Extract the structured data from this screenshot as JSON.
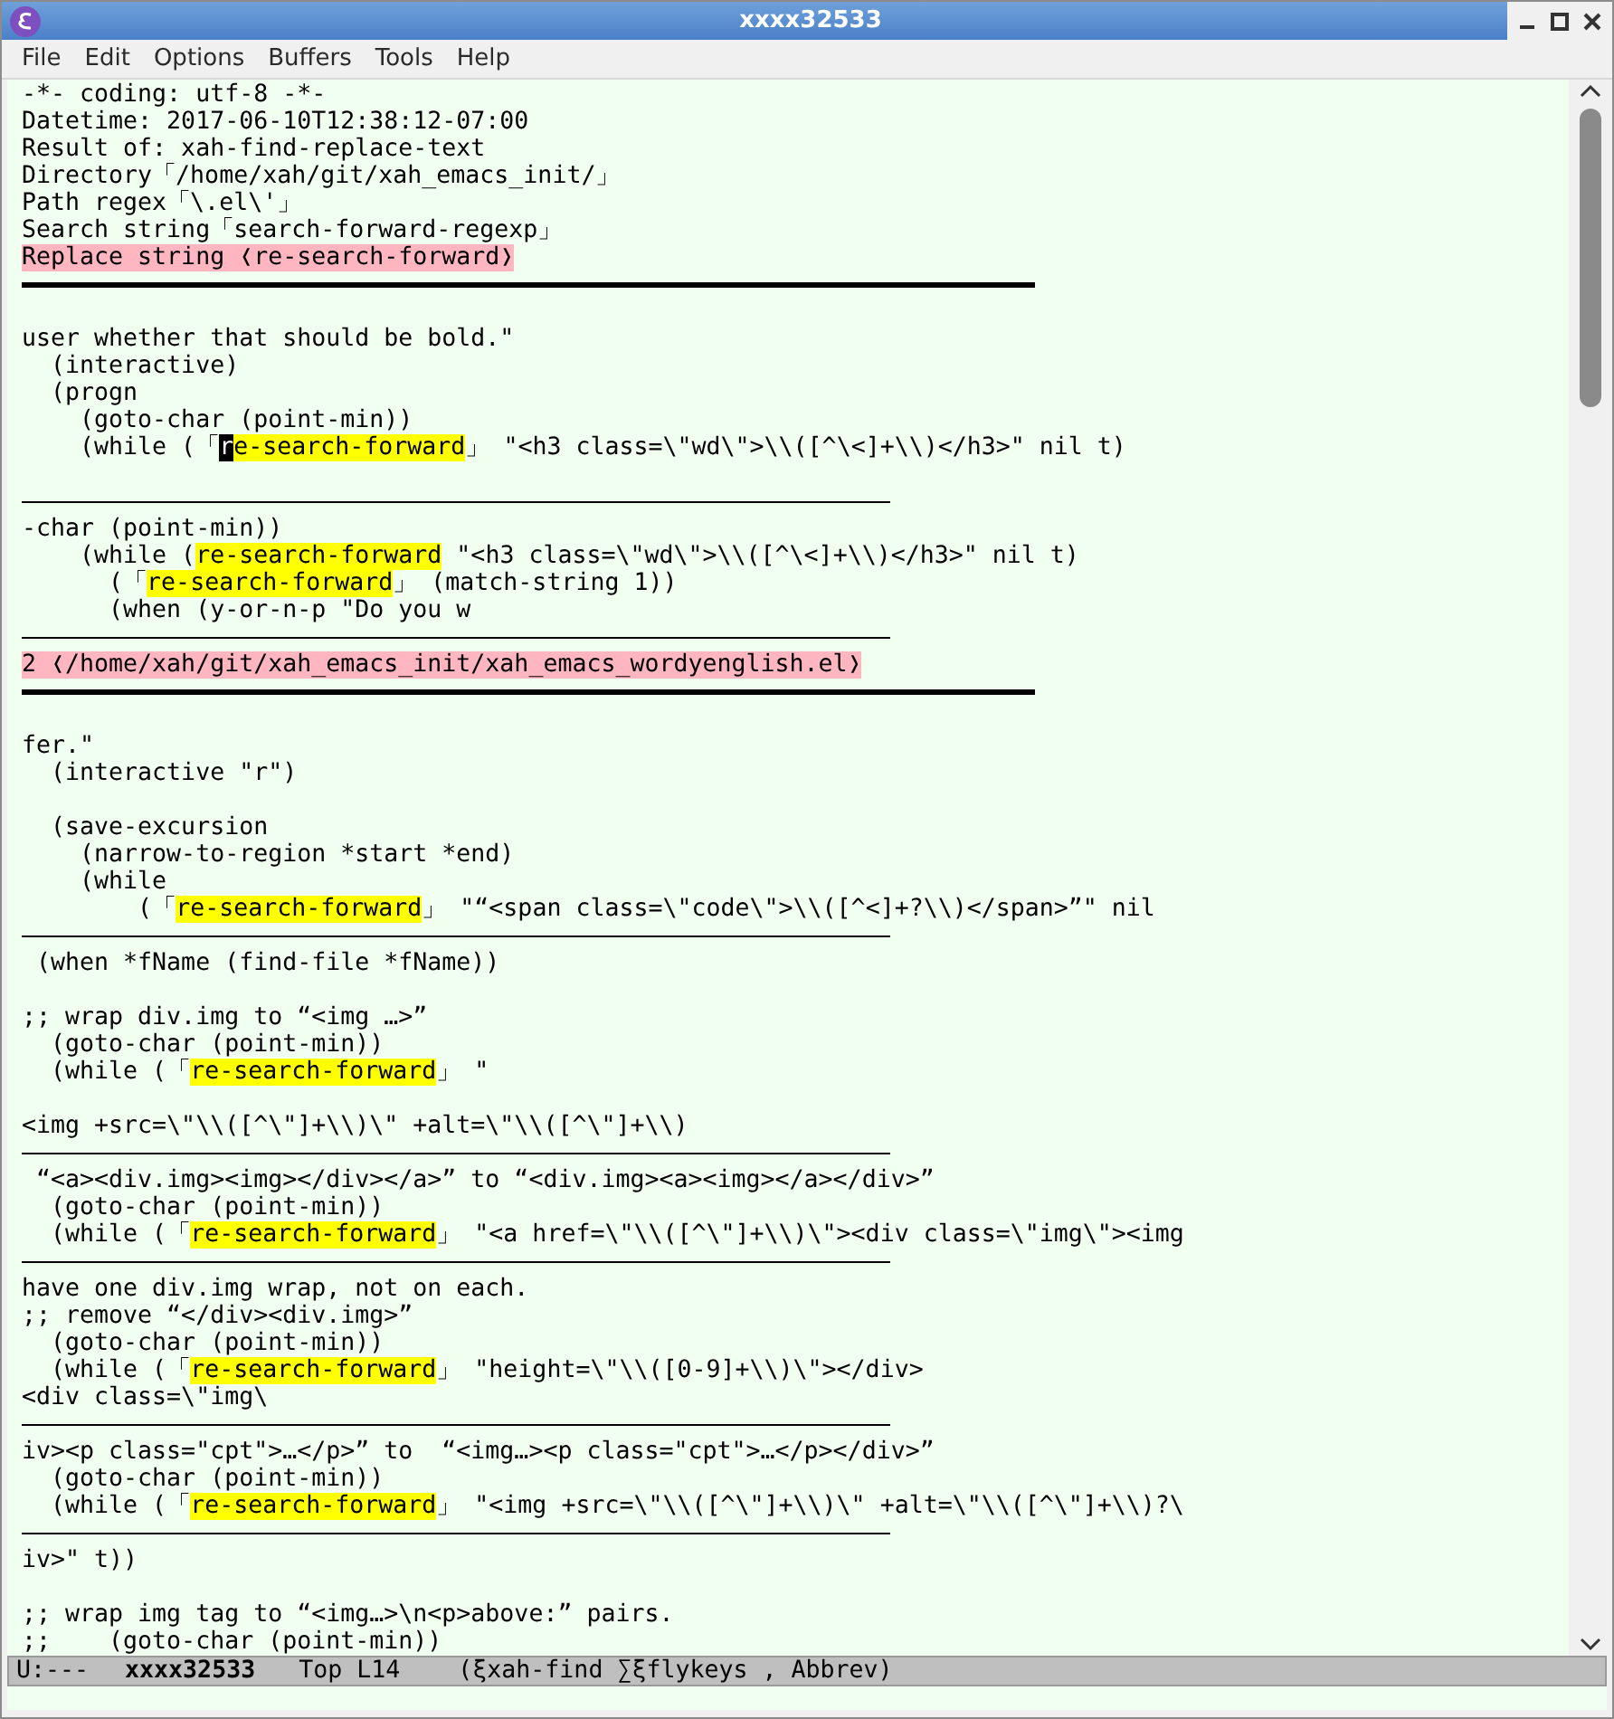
{
  "window": {
    "title": "xxxx32533"
  },
  "menu": [
    "File",
    "Edit",
    "Options",
    "Buffers",
    "Tools",
    "Help"
  ],
  "lines": [
    {
      "kind": "text",
      "segments": [
        {
          "kind": "plain",
          "text": "-*- coding: utf-8 -*-"
        }
      ]
    },
    {
      "kind": "text",
      "segments": [
        {
          "kind": "plain",
          "text": "Datetime: 2017-06-10T12:38:12-07:00"
        }
      ]
    },
    {
      "kind": "text",
      "segments": [
        {
          "kind": "plain",
          "text": "Result of: xah-find-replace-text"
        }
      ]
    },
    {
      "kind": "text",
      "segments": [
        {
          "kind": "plain",
          "text": "Directory「/home/xah/git/xah_emacs_init/」"
        }
      ]
    },
    {
      "kind": "text",
      "segments": [
        {
          "kind": "plain",
          "text": "Path regex「\\.el\\'」"
        }
      ]
    },
    {
      "kind": "text",
      "segments": [
        {
          "kind": "plain",
          "text": "Search string「search-forward-regexp」"
        }
      ]
    },
    {
      "kind": "text",
      "segments": [
        {
          "kind": "header",
          "text": "Replace string ❬re-search-forward❭"
        }
      ]
    },
    {
      "kind": "rule_thick"
    },
    {
      "kind": "blank"
    },
    {
      "kind": "text",
      "segments": [
        {
          "kind": "plain",
          "text": "user whether that should be bold.\""
        }
      ]
    },
    {
      "kind": "text",
      "segments": [
        {
          "kind": "plain",
          "text": "  (interactive)"
        }
      ]
    },
    {
      "kind": "text",
      "segments": [
        {
          "kind": "plain",
          "text": "  (progn"
        }
      ]
    },
    {
      "kind": "text",
      "segments": [
        {
          "kind": "plain",
          "text": "    (goto-char (point-min))"
        }
      ]
    },
    {
      "kind": "text",
      "segments": [
        {
          "kind": "plain",
          "text": "    (while (「"
        },
        {
          "kind": "cursor",
          "text": "r"
        },
        {
          "kind": "match",
          "text": "e-search-forward"
        },
        {
          "kind": "plain",
          "text": "」 \"<h3 class=\\\"wd\\\">\\\\([^\\<]+\\\\)</h3>\" nil t)"
        }
      ]
    },
    {
      "kind": "blank"
    },
    {
      "kind": "rule_thin"
    },
    {
      "kind": "text",
      "segments": [
        {
          "kind": "plain",
          "text": "-char (point-min))"
        }
      ]
    },
    {
      "kind": "text",
      "segments": [
        {
          "kind": "plain",
          "text": "    (while ("
        },
        {
          "kind": "match",
          "text": "re-search-forward"
        },
        {
          "kind": "plain",
          "text": " \"<h3 class=\\\"wd\\\">\\\\([^\\<]+\\\\)</h3>\" nil t)"
        }
      ]
    },
    {
      "kind": "text",
      "segments": [
        {
          "kind": "plain",
          "text": "      (「"
        },
        {
          "kind": "match",
          "text": "re-search-forward"
        },
        {
          "kind": "plain",
          "text": "」 (match-string 1))"
        }
      ]
    },
    {
      "kind": "text",
      "segments": [
        {
          "kind": "plain",
          "text": "      (when (y-or-n-p \"Do you w"
        }
      ]
    },
    {
      "kind": "rule_thin"
    },
    {
      "kind": "text",
      "segments": [
        {
          "kind": "header",
          "text": "2 ❬/home/xah/git/xah_emacs_init/xah_emacs_wordyenglish.el❭"
        }
      ]
    },
    {
      "kind": "rule_thick"
    },
    {
      "kind": "blank"
    },
    {
      "kind": "text",
      "segments": [
        {
          "kind": "plain",
          "text": "fer.\""
        }
      ]
    },
    {
      "kind": "text",
      "segments": [
        {
          "kind": "plain",
          "text": "  (interactive \"r\")"
        }
      ]
    },
    {
      "kind": "blank"
    },
    {
      "kind": "text",
      "segments": [
        {
          "kind": "plain",
          "text": "  (save-excursion"
        }
      ]
    },
    {
      "kind": "text",
      "segments": [
        {
          "kind": "plain",
          "text": "    (narrow-to-region *start *end)"
        }
      ]
    },
    {
      "kind": "text",
      "segments": [
        {
          "kind": "plain",
          "text": "    (while"
        }
      ]
    },
    {
      "kind": "text",
      "segments": [
        {
          "kind": "plain",
          "text": "        (「"
        },
        {
          "kind": "match",
          "text": "re-search-forward"
        },
        {
          "kind": "plain",
          "text": "」 \"“<span class=\\\"code\\\">\\\\([^<]+?\\\\)</span>”\" nil"
        }
      ]
    },
    {
      "kind": "rule_thin"
    },
    {
      "kind": "text",
      "segments": [
        {
          "kind": "plain",
          "text": " (when *fName (find-file *fName))"
        }
      ]
    },
    {
      "kind": "blank"
    },
    {
      "kind": "text",
      "segments": [
        {
          "kind": "plain",
          "text": ";; wrap div.img to “<img …>”"
        }
      ]
    },
    {
      "kind": "text",
      "segments": [
        {
          "kind": "plain",
          "text": "  (goto-char (point-min))"
        }
      ]
    },
    {
      "kind": "text",
      "segments": [
        {
          "kind": "plain",
          "text": "  (while (「"
        },
        {
          "kind": "match",
          "text": "re-search-forward"
        },
        {
          "kind": "plain",
          "text": "」 \""
        }
      ]
    },
    {
      "kind": "blank"
    },
    {
      "kind": "text",
      "segments": [
        {
          "kind": "plain",
          "text": "<img +src=\\\"\\\\([^\\\"]+\\\\)\\\" +alt=\\\"\\\\([^\\\"]+\\\\)"
        }
      ]
    },
    {
      "kind": "rule_thin"
    },
    {
      "kind": "text",
      "segments": [
        {
          "kind": "plain",
          "text": " “<a><div.img><img></div></a>” to “<div.img><a><img></a></div>”"
        }
      ]
    },
    {
      "kind": "text",
      "segments": [
        {
          "kind": "plain",
          "text": "  (goto-char (point-min))"
        }
      ]
    },
    {
      "kind": "text",
      "segments": [
        {
          "kind": "plain",
          "text": "  (while (「"
        },
        {
          "kind": "match",
          "text": "re-search-forward"
        },
        {
          "kind": "plain",
          "text": "」 \"<a href=\\\"\\\\([^\\\"]+\\\\)\\\"><div class=\\\"img\\\"><img"
        }
      ]
    },
    {
      "kind": "rule_thin"
    },
    {
      "kind": "text",
      "segments": [
        {
          "kind": "plain",
          "text": "have one div.img wrap, not on each."
        }
      ]
    },
    {
      "kind": "text",
      "segments": [
        {
          "kind": "plain",
          "text": ";; remove “</div><div.img>”"
        }
      ]
    },
    {
      "kind": "text",
      "segments": [
        {
          "kind": "plain",
          "text": "  (goto-char (point-min))"
        }
      ]
    },
    {
      "kind": "text",
      "segments": [
        {
          "kind": "plain",
          "text": "  (while (「"
        },
        {
          "kind": "match",
          "text": "re-search-forward"
        },
        {
          "kind": "plain",
          "text": "」 \"height=\\\"\\\\([0-9]+\\\\)\\\"></div>"
        }
      ]
    },
    {
      "kind": "text",
      "segments": [
        {
          "kind": "plain",
          "text": "<div class=\\\"img\\"
        }
      ]
    },
    {
      "kind": "rule_thin"
    },
    {
      "kind": "text",
      "segments": [
        {
          "kind": "plain",
          "text": "iv><p class=\"cpt\">…</p>” to  “<img…><p class=\"cpt\">…</p></div>”"
        }
      ]
    },
    {
      "kind": "text",
      "segments": [
        {
          "kind": "plain",
          "text": "  (goto-char (point-min))"
        }
      ]
    },
    {
      "kind": "text",
      "segments": [
        {
          "kind": "plain",
          "text": "  (while (「"
        },
        {
          "kind": "match",
          "text": "re-search-forward"
        },
        {
          "kind": "plain",
          "text": "」 \"<img +src=\\\"\\\\([^\\\"]+\\\\)\\\" +alt=\\\"\\\\([^\\\"]+\\\\)?\\"
        }
      ]
    },
    {
      "kind": "rule_thin"
    },
    {
      "kind": "text",
      "segments": [
        {
          "kind": "plain",
          "text": "iv>\" t))"
        }
      ]
    },
    {
      "kind": "blank"
    },
    {
      "kind": "text",
      "segments": [
        {
          "kind": "plain",
          "text": ";; wrap img tag to “<img…>\\n<p>above:” pairs."
        }
      ]
    },
    {
      "kind": "text",
      "segments": [
        {
          "kind": "plain",
          "text": ";;    (goto-char (point-min))"
        }
      ]
    }
  ],
  "mode_line": {
    "status": "U:---",
    "buffer": "xxxx32533",
    "position": "Top L14",
    "modes": "(ξxah-find ∑ξflykeys , Abbrev)"
  }
}
